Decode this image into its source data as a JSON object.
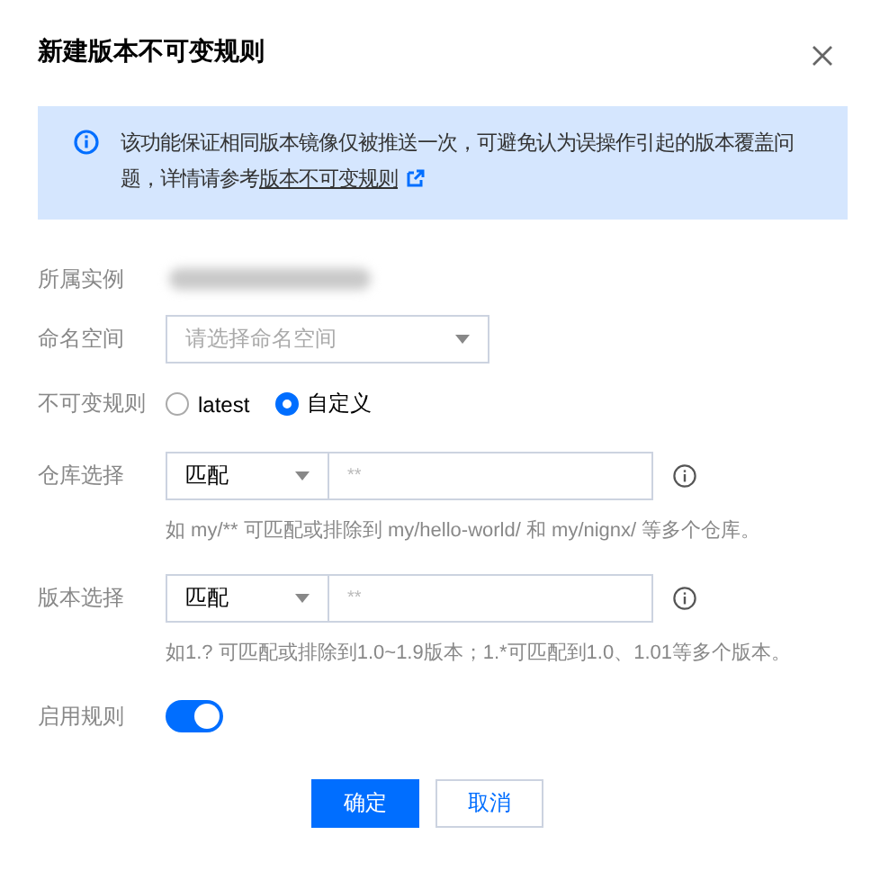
{
  "dialog": {
    "title": "新建版本不可变规则"
  },
  "notice": {
    "text": "该功能保证相同版本镜像仅被推送一次，可避免认为误操作引起的版本覆盖问题，详情请参考",
    "link": "版本不可变规则"
  },
  "fields": [
    {
      "kind": "redacted",
      "label": "所属实例"
    },
    {
      "kind": "select",
      "label": "命名空间",
      "placeholder": "请选择命名空间"
    },
    {
      "kind": "radio",
      "label": "不可变规则",
      "options": [
        {
          "label": "latest",
          "selected": false
        },
        {
          "label": "自定义",
          "selected": true
        }
      ]
    },
    {
      "kind": "match",
      "label": "仓库选择",
      "select_value": "匹配",
      "placeholder": "**",
      "help": "如 my/** 可匹配或排除到 my/hello-world/ 和 my/nignx/ 等多个仓库。"
    },
    {
      "kind": "match",
      "label": "版本选择",
      "select_value": "匹配",
      "placeholder": "**",
      "help": "如1.?  可匹配或排除到1.0~1.9版本；1.*可匹配到1.0、1.01等多个版本。"
    },
    {
      "kind": "switch",
      "label": "启用规则",
      "on": true
    }
  ],
  "buttons": [
    {
      "label": "确定",
      "kind": "primary"
    },
    {
      "label": "取消",
      "kind": "secondary"
    }
  ]
}
